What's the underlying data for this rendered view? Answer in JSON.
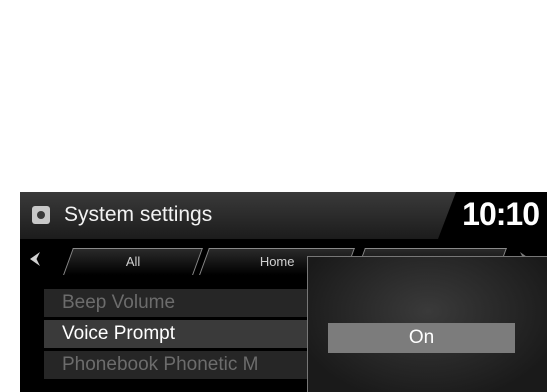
{
  "header": {
    "title": "System settings",
    "clock": "10:10",
    "icon": "gear-icon"
  },
  "tabs": [
    {
      "label": "All"
    },
    {
      "label": "Home"
    },
    {
      "label": ""
    }
  ],
  "settings_list": [
    {
      "label": "Beep Volume",
      "state": "dimmed"
    },
    {
      "label": "Voice Prompt",
      "state": "selected"
    },
    {
      "label": "Phonebook Phonetic M",
      "state": "dimmed"
    }
  ],
  "popup": {
    "options": [
      {
        "label": "On",
        "highlighted": true
      }
    ]
  },
  "colors": {
    "highlight": "#7c7c7c",
    "background": "#000000",
    "text": "#ffffff"
  }
}
